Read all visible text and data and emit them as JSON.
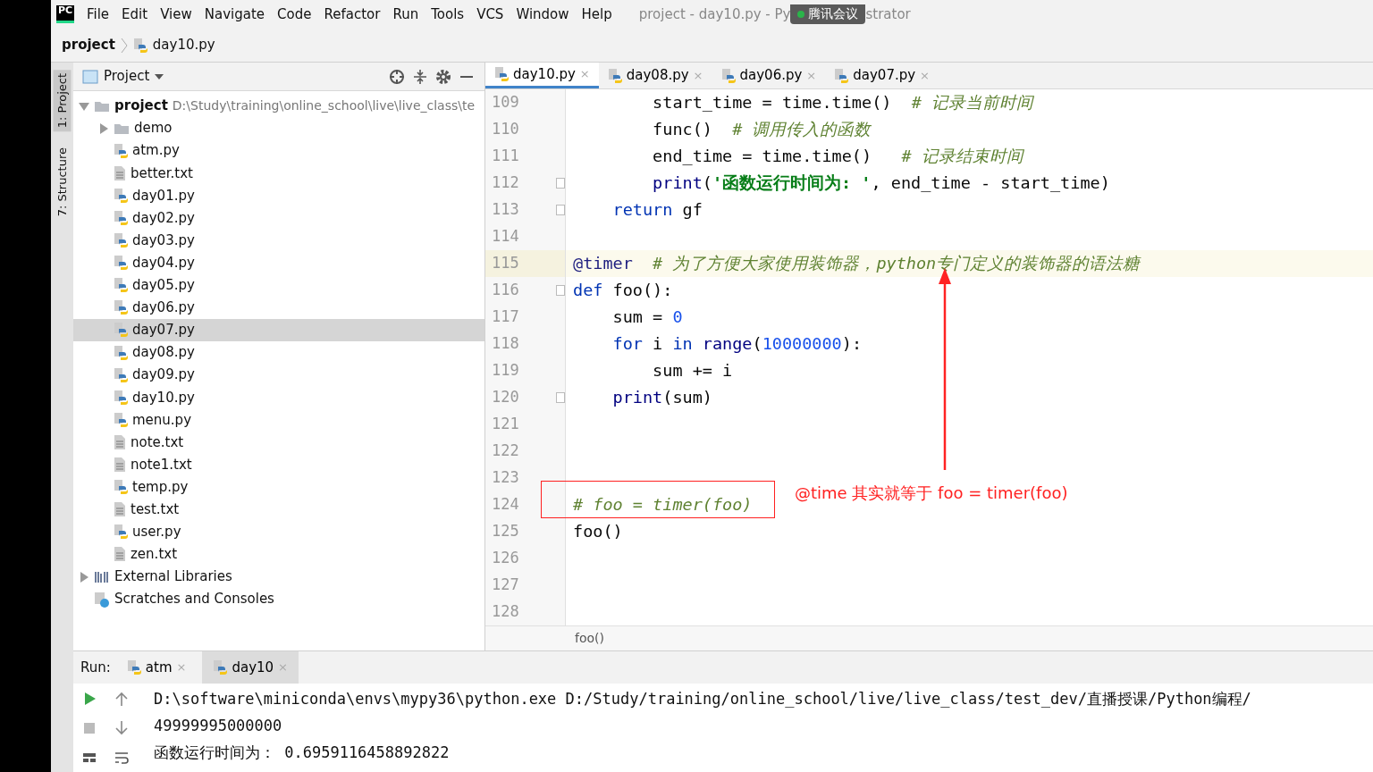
{
  "window": {
    "logo": "PC",
    "menu": [
      "File",
      "Edit",
      "View",
      "Navigate",
      "Code",
      "Refactor",
      "Run",
      "Tools",
      "VCS",
      "Window",
      "Help"
    ],
    "title_parts": [
      "project - day10.py - Py",
      "strator"
    ]
  },
  "meeting_overlay": {
    "label": "腾讯会议"
  },
  "breadcrumb": [
    "project",
    "day10.py"
  ],
  "tool_strip": [
    {
      "label": "1: Project",
      "selected": true
    },
    {
      "label": "7: Structure",
      "selected": false
    }
  ],
  "project_panel": {
    "title": "Project",
    "tree": [
      {
        "label": "project",
        "path": "D:\\Study\\training\\online_school\\live\\live_class\\te",
        "kind": "root",
        "expanded": true,
        "selected": false,
        "children": [
          {
            "label": "demo",
            "kind": "folder",
            "expanded": false,
            "selected": false
          },
          {
            "label": "atm.py",
            "kind": "py",
            "selected": false
          },
          {
            "label": "better.txt",
            "kind": "txt",
            "selected": false
          },
          {
            "label": "day01.py",
            "kind": "py",
            "selected": false
          },
          {
            "label": "day02.py",
            "kind": "py",
            "selected": false
          },
          {
            "label": "day03.py",
            "kind": "py",
            "selected": false
          },
          {
            "label": "day04.py",
            "kind": "py",
            "selected": false
          },
          {
            "label": "day05.py",
            "kind": "py",
            "selected": false
          },
          {
            "label": "day06.py",
            "kind": "py",
            "selected": false
          },
          {
            "label": "day07.py",
            "kind": "py",
            "selected": true
          },
          {
            "label": "day08.py",
            "kind": "py",
            "selected": false
          },
          {
            "label": "day09.py",
            "kind": "py",
            "selected": false
          },
          {
            "label": "day10.py",
            "kind": "py",
            "selected": false
          },
          {
            "label": "menu.py",
            "kind": "py",
            "selected": false
          },
          {
            "label": "note.txt",
            "kind": "txt",
            "selected": false
          },
          {
            "label": "note1.txt",
            "kind": "txt",
            "selected": false
          },
          {
            "label": "temp.py",
            "kind": "py",
            "selected": false
          },
          {
            "label": "test.txt",
            "kind": "txt",
            "selected": false
          },
          {
            "label": "user.py",
            "kind": "py",
            "selected": false
          },
          {
            "label": "zen.txt",
            "kind": "txt",
            "selected": false
          }
        ]
      },
      {
        "label": "External Libraries",
        "kind": "library",
        "expanded": false,
        "selected": false
      },
      {
        "label": "Scratches and Consoles",
        "kind": "scratch",
        "selected": false
      }
    ]
  },
  "editor_tabs": [
    {
      "label": "day10.py",
      "close": "×",
      "selected": true
    },
    {
      "label": "day08.py",
      "close": "×",
      "selected": false
    },
    {
      "label": "day06.py",
      "close": "×",
      "selected": false
    },
    {
      "label": "day07.py",
      "close": "×",
      "selected": false
    }
  ],
  "code_lines": [
    {
      "number": "109",
      "fold": false,
      "current": false,
      "tokens": [
        {
          "t": "        start_time = time.time()  ",
          "kind": "plain"
        },
        {
          "t": "# 记录当前时间",
          "kind": "comment"
        }
      ]
    },
    {
      "number": "110",
      "fold": false,
      "current": false,
      "tokens": [
        {
          "t": "        func()  ",
          "kind": "plain"
        },
        {
          "t": "# 调用传入的函数",
          "kind": "comment"
        }
      ]
    },
    {
      "number": "111",
      "fold": false,
      "current": false,
      "tokens": [
        {
          "t": "        end_time = time.time()   ",
          "kind": "plain"
        },
        {
          "t": "# 记录结束时间",
          "kind": "comment"
        }
      ]
    },
    {
      "number": "112",
      "fold": true,
      "current": false,
      "tokens": [
        {
          "t": "        print",
          "kind": "builtin"
        },
        {
          "t": "(",
          "kind": "plain"
        },
        {
          "t": "'函数运行时间为: '",
          "kind": "str"
        },
        {
          "t": ", end_time - start_time)",
          "kind": "plain"
        }
      ]
    },
    {
      "number": "113",
      "fold": true,
      "current": false,
      "tokens": [
        {
          "t": "    return",
          "kind": "kw"
        },
        {
          "t": " gf",
          "kind": "plain"
        }
      ]
    },
    {
      "number": "114",
      "fold": false,
      "current": false
    },
    {
      "number": "115",
      "fold": false,
      "current": true,
      "tokens": [
        {
          "t": "@timer",
          "kind": "deco"
        },
        {
          "t": "  # 为了方便大家使用装饰器，python专门定义的装饰器的语法糖",
          "kind": "comment"
        }
      ]
    },
    {
      "number": "116",
      "fold": true,
      "current": false,
      "tokens": [
        {
          "t": "def",
          "kind": "kw"
        },
        {
          "t": " foo():",
          "kind": "plain"
        }
      ]
    },
    {
      "number": "117",
      "fold": false,
      "current": false,
      "tokens": [
        {
          "t": "    sum = ",
          "kind": "plain"
        },
        {
          "t": "0",
          "kind": "num"
        }
      ]
    },
    {
      "number": "118",
      "fold": false,
      "current": false,
      "tokens": [
        {
          "t": "    for",
          "kind": "kw"
        },
        {
          "t": " i ",
          "kind": "plain"
        },
        {
          "t": "in",
          "kind": "kw"
        },
        {
          "t": " range",
          "kind": "builtin"
        },
        {
          "t": "(",
          "kind": "plain"
        },
        {
          "t": "10000000",
          "kind": "num"
        },
        {
          "t": "):",
          "kind": "plain"
        }
      ]
    },
    {
      "number": "119",
      "fold": false,
      "current": false,
      "tokens": [
        {
          "t": "        sum += i",
          "kind": "plain"
        }
      ]
    },
    {
      "number": "120",
      "fold": true,
      "current": false,
      "tokens": [
        {
          "t": "    print",
          "kind": "builtin"
        },
        {
          "t": "(sum)",
          "kind": "plain"
        }
      ]
    },
    {
      "number": "121",
      "fold": false,
      "current": false
    },
    {
      "number": "122",
      "fold": false,
      "current": false
    },
    {
      "number": "123",
      "fold": false,
      "current": false
    },
    {
      "number": "124",
      "fold": false,
      "current": false,
      "tokens": [
        {
          "t": "# foo = timer(foo)",
          "kind": "comment"
        }
      ]
    },
    {
      "number": "125",
      "fold": false,
      "current": false,
      "tokens": [
        {
          "t": "foo()",
          "kind": "plain"
        }
      ]
    },
    {
      "number": "126",
      "fold": false,
      "current": false
    },
    {
      "number": "127",
      "fold": false,
      "current": false
    },
    {
      "number": "128",
      "fold": false,
      "current": false
    }
  ],
  "annotations": [
    {
      "kind": "box"
    },
    {
      "kind": "arrow"
    },
    {
      "kind": "note",
      "text": "@time 其实就等于 foo = timer(foo)"
    }
  ],
  "editor_breadcrumb": "foo()",
  "run_panel": {
    "label": "Run:",
    "tabs": [
      {
        "label": "atm",
        "close": "×",
        "selected": false
      },
      {
        "label": "day10",
        "close": "×",
        "selected": true
      }
    ],
    "output": [
      "D:\\software\\miniconda\\envs\\mypy36\\python.exe D:/Study/training/online_school/live/live_class/test_dev/直播授课/Python编程/",
      "49999995000000",
      "函数运行时间为： 0.6959116458892822"
    ]
  }
}
